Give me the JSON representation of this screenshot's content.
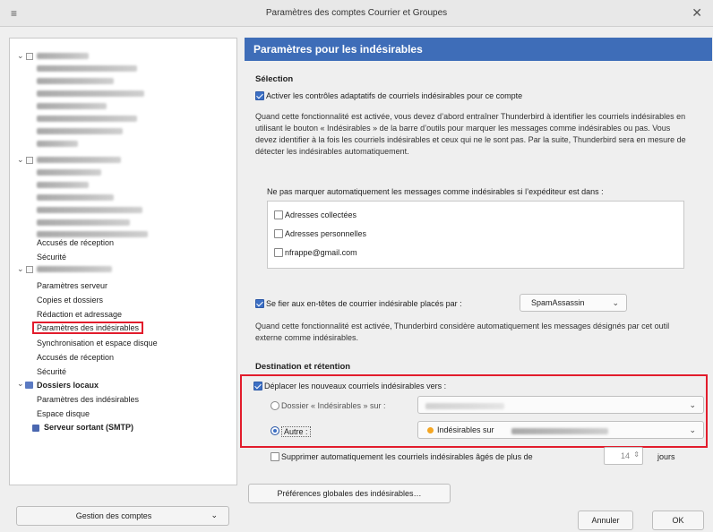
{
  "window": {
    "title": "Paramètres des comptes Courrier et Groupes",
    "menu_icon": "≡",
    "close_icon": "✕"
  },
  "sidebar": {
    "items": [
      {
        "label": "Accusés de réception"
      },
      {
        "label": "Sécurité"
      },
      {
        "label": "Paramètres serveur"
      },
      {
        "label": "Copies et dossiers"
      },
      {
        "label": "Rédaction et adressage"
      },
      {
        "label": "Paramètres des indésirables"
      },
      {
        "label": "Synchronisation et espace disque"
      },
      {
        "label": "Accusés de réception"
      },
      {
        "label": "Sécurité"
      },
      {
        "label": "Dossiers locaux"
      },
      {
        "label": "Paramètres des indésirables"
      },
      {
        "label": "Espace disque"
      },
      {
        "label": "Serveur sortant (SMTP)"
      }
    ],
    "manage_button": "Gestion des comptes"
  },
  "panel": {
    "header": "Paramètres pour les indésirables",
    "selection": {
      "title": "Sélection",
      "adaptive_label": "Activer les contrôles adaptatifs de courriels indésirables pour ce compte",
      "adaptive_description": "Quand cette fonctionnalité est activée, vous devez d’abord entraîner Thunderbird à identifier les courriels indésirables en utilisant le bouton « Indésirables » de la barre d’outils pour marquer les messages comme indésirables ou pas. Vous devez identifier à la fois les courriels indésirables et ceux qui ne le sont pas. Par la suite, Thunderbird sera en mesure de détecter les indésirables automatiquement.",
      "whitelist_label": "Ne pas marquer automatiquement les messages comme indésirables si l’expéditeur est dans :",
      "whitelist_items": [
        {
          "label": "Adresses collectées"
        },
        {
          "label": "Adresses personnelles"
        },
        {
          "label": "nfrappe@gmail.com"
        }
      ],
      "trust_label": "Se fier aux en-têtes de courrier indésirable placés par :",
      "trust_value": "SpamAssassin",
      "trust_description": "Quand cette fonctionnalité est activée, Thunderbird considère automatiquement les messages désignés par cet outil externe comme indésirables."
    },
    "destination": {
      "title": "Destination et rétention",
      "move_label": "Déplacer les nouveaux courriels indésirables vers :",
      "folder_option": "Dossier « Indésirables » sur :",
      "other_option": "Autre :",
      "other_value": "Indésirables sur",
      "delete_label": "Supprimer automatiquement les courriels indésirables âgés de plus de",
      "delete_days": "14",
      "days_unit": "jours"
    },
    "global_prefs_button": "Préférences globales des indésirables…"
  },
  "footer": {
    "cancel": "Annuler",
    "ok": "OK"
  }
}
